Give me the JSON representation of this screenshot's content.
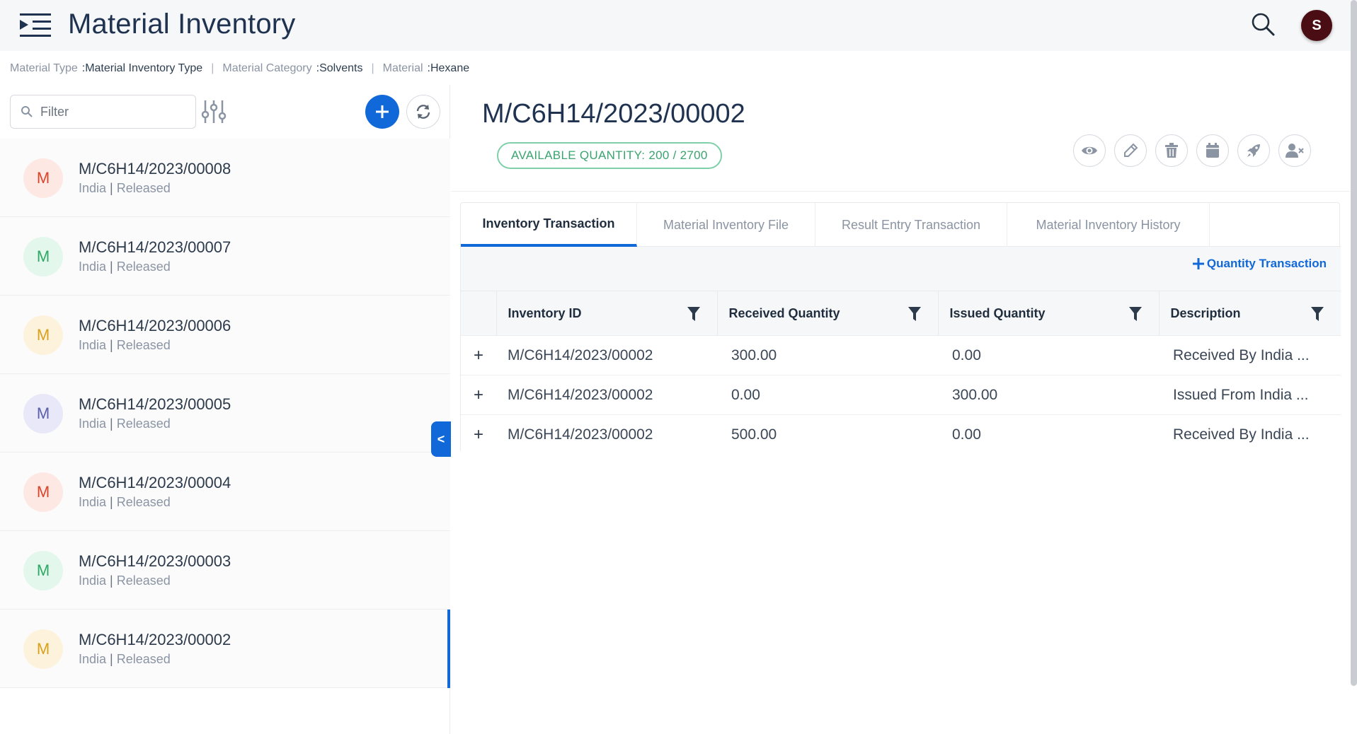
{
  "app": {
    "title": "Material Inventory",
    "user_initial": "S"
  },
  "breadcrumb": [
    {
      "label": "Material Type",
      "value": ":Material Inventory Type"
    },
    {
      "label": "Material Category",
      "value": ":Solvents"
    },
    {
      "label": "Material",
      "value": ":Hexane"
    }
  ],
  "left": {
    "filter_placeholder": "Filter",
    "collapse_label": "<",
    "items": [
      {
        "initial": "M",
        "title": "M/C6H14/2023/00008",
        "site": "India",
        "status": "Released",
        "bg": "#fde8e3",
        "fg": "#d9452b"
      },
      {
        "initial": "M",
        "title": "M/C6H14/2023/00007",
        "site": "India",
        "status": "Released",
        "bg": "#e3f7ec",
        "fg": "#2fa866"
      },
      {
        "initial": "M",
        "title": "M/C6H14/2023/00006",
        "site": "India",
        "status": "Released",
        "bg": "#fdf3dc",
        "fg": "#d9a01e"
      },
      {
        "initial": "M",
        "title": "M/C6H14/2023/00005",
        "site": "India",
        "status": "Released",
        "bg": "#e8e8f8",
        "fg": "#5b5ea8"
      },
      {
        "initial": "M",
        "title": "M/C6H14/2023/00004",
        "site": "India",
        "status": "Released",
        "bg": "#fde8e3",
        "fg": "#d9452b"
      },
      {
        "initial": "M",
        "title": "M/C6H14/2023/00003",
        "site": "India",
        "status": "Released",
        "bg": "#e3f7ec",
        "fg": "#2fa866"
      },
      {
        "initial": "M",
        "title": "M/C6H14/2023/00002",
        "site": "India",
        "status": "Released",
        "bg": "#fdf3dc",
        "fg": "#d9a01e"
      }
    ]
  },
  "detail": {
    "title": "M/C6H14/2023/00002",
    "available_quantity": "AVAILABLE QUANTITY: 200 / 2700",
    "actions": [
      "eye-icon",
      "pencil-icon",
      "trash-icon",
      "calendar-icon",
      "rocket-icon",
      "user-remove-icon"
    ],
    "tabs": [
      "Inventory Transaction",
      "Material Inventory File",
      "Result Entry Transaction",
      "Material Inventory History"
    ],
    "quantity_transaction_label": "Quantity Transaction",
    "table": {
      "columns": [
        "Inventory ID",
        "Received Quantity",
        "Issued Quantity",
        "Description"
      ],
      "rows": [
        {
          "id": "M/C6H14/2023/00002",
          "received": "300.00",
          "issued": "0.00",
          "description": "Received By India ..."
        },
        {
          "id": "M/C6H14/2023/00002",
          "received": "0.00",
          "issued": "300.00",
          "description": "Issued From India ..."
        },
        {
          "id": "M/C6H14/2023/00002",
          "received": "500.00",
          "issued": "0.00",
          "description": "Received By India ..."
        }
      ]
    }
  },
  "colors": {
    "accent": "#1168d8",
    "title": "#1f3250",
    "badge_green": "#3aa46f"
  }
}
